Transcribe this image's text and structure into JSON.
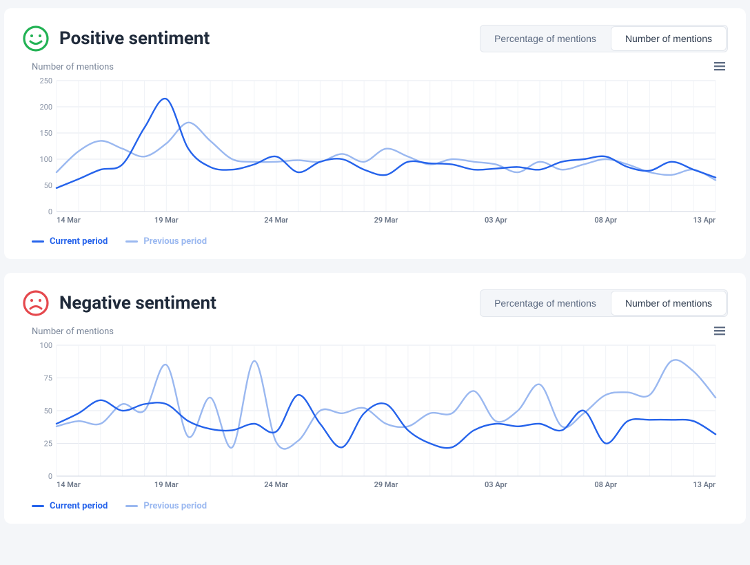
{
  "toggle": {
    "percentage": "Percentage of mentions",
    "number": "Number of mentions"
  },
  "legend": {
    "current": "Current period",
    "previous": "Previous period"
  },
  "positive": {
    "title": "Positive sentiment",
    "ylabel": "Number of mentions",
    "icon_color": "#22b254"
  },
  "negative": {
    "title": "Negative sentiment",
    "ylabel": "Number of mentions",
    "icon_color": "#e5484d"
  },
  "chart_data": [
    {
      "id": "positive",
      "type": "line",
      "title": "Positive sentiment",
      "xlabel": "",
      "ylabel": "Number of mentions",
      "ylim": [
        0,
        250
      ],
      "yticks": [
        0,
        50,
        100,
        150,
        200,
        250
      ],
      "x_dates": [
        "14 Mar",
        "15 Mar",
        "16 Mar",
        "17 Mar",
        "18 Mar",
        "19 Mar",
        "20 Mar",
        "21 Mar",
        "22 Mar",
        "23 Mar",
        "24 Mar",
        "25 Mar",
        "26 Mar",
        "27 Mar",
        "28 Mar",
        "29 Mar",
        "30 Mar",
        "31 Mar",
        "01 Apr",
        "02 Apr",
        "03 Apr",
        "04 Apr",
        "05 Apr",
        "06 Apr",
        "07 Apr",
        "08 Apr",
        "09 Apr",
        "10 Apr",
        "11 Apr",
        "12 Apr",
        "13 Apr"
      ],
      "x_tick_labels": [
        "14 Mar",
        "19 Mar",
        "24 Mar",
        "29 Mar",
        "03 Apr",
        "08 Apr",
        "13 Apr"
      ],
      "x_tick_indices": [
        0,
        5,
        10,
        15,
        20,
        25,
        30
      ],
      "series": [
        {
          "name": "Current period",
          "color": "#2563eb",
          "values": [
            45,
            62,
            80,
            90,
            160,
            215,
            120,
            85,
            80,
            90,
            105,
            75,
            95,
            100,
            80,
            70,
            95,
            92,
            90,
            80,
            82,
            85,
            80,
            95,
            100,
            105,
            85,
            78,
            95,
            80,
            65
          ]
        },
        {
          "name": "Previous period",
          "color": "#9ab8f0",
          "values": [
            75,
            115,
            135,
            120,
            105,
            130,
            170,
            135,
            100,
            95,
            95,
            98,
            95,
            110,
            95,
            120,
            105,
            90,
            100,
            95,
            90,
            75,
            95,
            80,
            90,
            100,
            90,
            75,
            70,
            80,
            60
          ]
        }
      ]
    },
    {
      "id": "negative",
      "type": "line",
      "title": "Negative sentiment",
      "xlabel": "",
      "ylabel": "Number of mentions",
      "ylim": [
        0,
        100
      ],
      "yticks": [
        0,
        25,
        50,
        75,
        100
      ],
      "x_dates": [
        "14 Mar",
        "15 Mar",
        "16 Mar",
        "17 Mar",
        "18 Mar",
        "19 Mar",
        "20 Mar",
        "21 Mar",
        "22 Mar",
        "23 Mar",
        "24 Mar",
        "25 Mar",
        "26 Mar",
        "27 Mar",
        "28 Mar",
        "29 Mar",
        "30 Mar",
        "31 Mar",
        "01 Apr",
        "02 Apr",
        "03 Apr",
        "04 Apr",
        "05 Apr",
        "06 Apr",
        "07 Apr",
        "08 Apr",
        "09 Apr",
        "10 Apr",
        "11 Apr",
        "12 Apr",
        "13 Apr"
      ],
      "x_tick_labels": [
        "14 Mar",
        "19 Mar",
        "24 Mar",
        "29 Mar",
        "03 Apr",
        "08 Apr",
        "13 Apr"
      ],
      "x_tick_indices": [
        0,
        5,
        10,
        15,
        20,
        25,
        30
      ],
      "series": [
        {
          "name": "Current period",
          "color": "#2563eb",
          "values": [
            40,
            48,
            58,
            50,
            55,
            55,
            42,
            36,
            35,
            40,
            34,
            62,
            40,
            22,
            48,
            55,
            35,
            25,
            22,
            35,
            40,
            38,
            40,
            35,
            50,
            25,
            42,
            43,
            43,
            42,
            32
          ]
        },
        {
          "name": "Previous period",
          "color": "#9ab8f0",
          "values": [
            38,
            42,
            40,
            55,
            50,
            85,
            30,
            60,
            22,
            88,
            26,
            27,
            50,
            48,
            52,
            40,
            38,
            48,
            48,
            65,
            42,
            50,
            70,
            38,
            48,
            62,
            64,
            62,
            88,
            80,
            60
          ]
        }
      ]
    }
  ]
}
